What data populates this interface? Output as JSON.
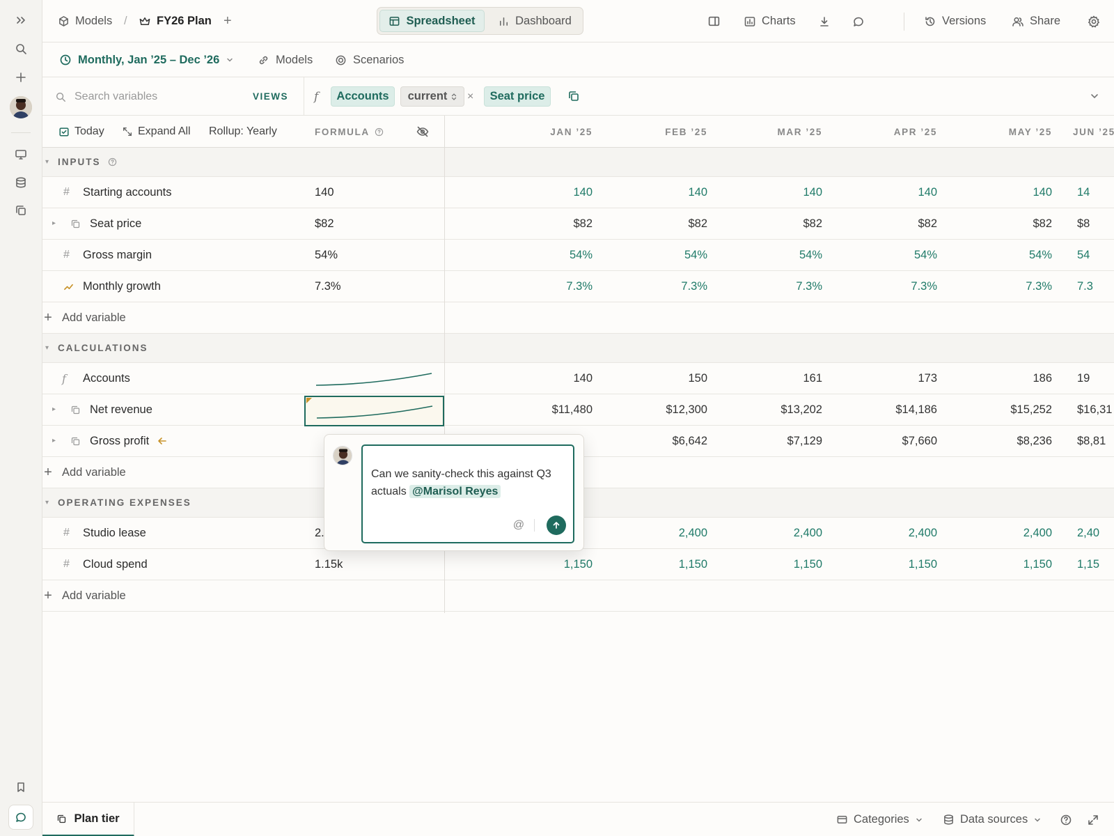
{
  "nav": {
    "models": "Models",
    "plan": "FY26 Plan",
    "spreadsheet": "Spreadsheet",
    "dashboard": "Dashboard",
    "charts": "Charts",
    "versions": "Versions",
    "share": "Share"
  },
  "subnav": {
    "range": "Monthly, Jan ’25 – Dec ’26",
    "models": "Models",
    "scenarios": "Scenarios"
  },
  "formula_bar": {
    "search_placeholder": "Search variables",
    "views": "VIEWS",
    "token_accounts": "Accounts",
    "token_current": "current",
    "token_seat": "Seat price",
    "times": "×"
  },
  "toolbar": {
    "today": "Today",
    "expand_all": "Expand All",
    "rollup": "Rollup: Yearly",
    "formula_header": "FORMULA"
  },
  "months": [
    "JAN ’25",
    "FEB ’25",
    "MAR ’25",
    "APR ’25",
    "MAY ’25",
    "JUN ’25"
  ],
  "sections": {
    "inputs": "INPUTS",
    "calculations": "CALCULATIONS",
    "opex": "OPERATING EXPENSES"
  },
  "rows": {
    "starting_accounts": {
      "name": "Starting accounts",
      "formula": "140",
      "values": [
        "140",
        "140",
        "140",
        "140",
        "140",
        "14"
      ]
    },
    "seat_price": {
      "name": "Seat price",
      "formula": "$82",
      "values": [
        "$82",
        "$82",
        "$82",
        "$82",
        "$82",
        "$8"
      ]
    },
    "gross_margin": {
      "name": "Gross margin",
      "formula": "54%",
      "values": [
        "54%",
        "54%",
        "54%",
        "54%",
        "54%",
        "54"
      ]
    },
    "monthly_growth": {
      "name": "Monthly growth",
      "formula": "7.3%",
      "values": [
        "7.3%",
        "7.3%",
        "7.3%",
        "7.3%",
        "7.3%",
        "7.3"
      ]
    },
    "accounts": {
      "name": "Accounts",
      "values": [
        "140",
        "150",
        "161",
        "173",
        "186",
        "19"
      ]
    },
    "net_revenue": {
      "name": "Net revenue",
      "values": [
        "$11,480",
        "$12,300",
        "$13,202",
        "$14,186",
        "$15,252",
        "$16,31"
      ]
    },
    "gross_profit": {
      "name": "Gross profit",
      "values": [
        "",
        "$6,642",
        "$7,129",
        "$7,660",
        "$8,236",
        "$8,81"
      ]
    },
    "studio_lease": {
      "name": "Studio lease",
      "formula": "2.",
      "values": [
        "",
        "2,400",
        "2,400",
        "2,400",
        "2,400",
        "2,40"
      ]
    },
    "cloud_spend": {
      "name": "Cloud spend",
      "formula": "1.15k",
      "values": [
        "1,150",
        "1,150",
        "1,150",
        "1,150",
        "1,150",
        "1,15"
      ]
    }
  },
  "add_variable": "Add variable",
  "comment": {
    "text": "Can we sanity-check this against Q3 actuals",
    "mention": "@Marisol Reyes"
  },
  "bottom": {
    "plan_tier": "Plan tier",
    "categories": "Categories",
    "data_sources": "Data sources"
  },
  "colors": {
    "accent": "#1f6b5e",
    "input_value": "#1f7a68",
    "arrow": "#c8932a"
  }
}
